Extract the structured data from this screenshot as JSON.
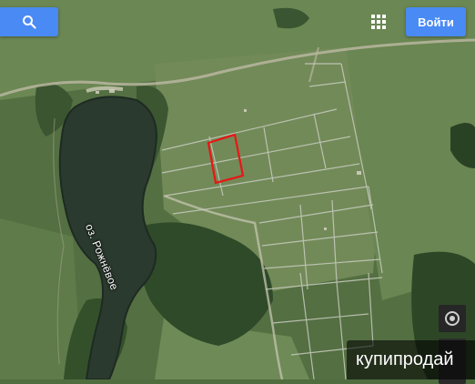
{
  "header": {
    "search_icon": "search-icon",
    "apps_icon": "apps-grid-icon",
    "signin_label": "Войти"
  },
  "map": {
    "lake_label": "оз. Рожнёвое",
    "selected_parcel_color": "#e81616",
    "lake_color": "#2b3a2e",
    "parcel_line_color": "#c8ccc0"
  },
  "controls": {
    "locate_icon": "my-location-icon"
  },
  "watermark": {
    "text": "купипродай"
  }
}
